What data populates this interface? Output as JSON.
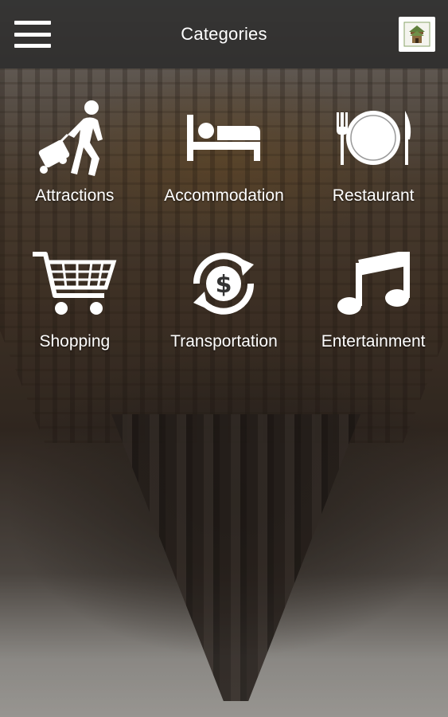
{
  "header": {
    "title": "Categories",
    "menu_icon": "hamburger-menu-icon",
    "logo_icon": "app-logo-icon"
  },
  "categories": [
    {
      "label": "Attractions",
      "icon": "traveler-suitcase-icon"
    },
    {
      "label": "Accommodation",
      "icon": "bed-icon"
    },
    {
      "label": "Restaurant",
      "icon": "plate-fork-knife-icon"
    },
    {
      "label": "Shopping",
      "icon": "shopping-cart-icon"
    },
    {
      "label": "Transportation",
      "icon": "currency-exchange-icon"
    },
    {
      "label": "Entertainment",
      "icon": "music-note-icon"
    }
  ],
  "colors": {
    "topbar": "#2a2a2a",
    "icon_text": "#ffffff"
  }
}
